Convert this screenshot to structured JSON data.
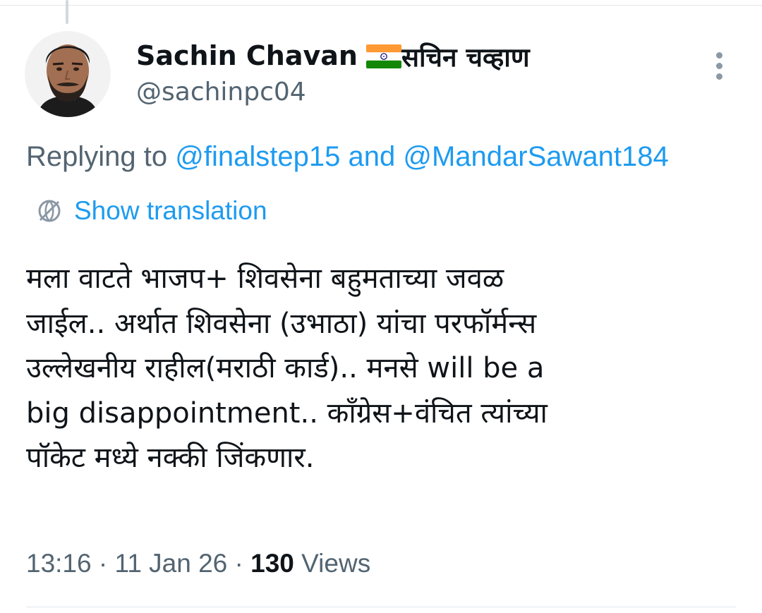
{
  "tweet": {
    "author": {
      "display_name": "Sachin Chavan",
      "flag_icon": "india-flag-icon",
      "display_name_alt": "सचिन चव्हाण",
      "handle": "@sachinpc04",
      "avatar_icon": "avatar"
    },
    "more_icon": "more-vertical-icon",
    "reply_context": {
      "prefix": "Replying to",
      "mention_1": "@finalstep15",
      "connector": "and",
      "mention_2": "@MandarSawant184"
    },
    "translation": {
      "icon": "globe-icon",
      "label": "Show translation"
    },
    "body_lines": [
      "मला वाटते भाजप+ शिवसेना  बहुमताच्या जवळ",
      "जाईल.. अर्थात शिवसेना (उभाठा) यांचा परफॉर्मन्स",
      "उल्लेखनीय राहील(मराठी कार्ड).. मनसे will be a",
      "big disappointment.. कॉंग्रेस+वंचित त्यांच्या",
      "पॉकेट मध्ये नक्की जिंकणार."
    ],
    "meta": {
      "time": "13:16",
      "separator": "·",
      "date": "11 Jan 26",
      "view_count": "130",
      "views_label": "Views"
    },
    "colors": {
      "link": "#1d9bf0",
      "secondary_text": "#536471",
      "primary_text": "#0f1419"
    }
  }
}
